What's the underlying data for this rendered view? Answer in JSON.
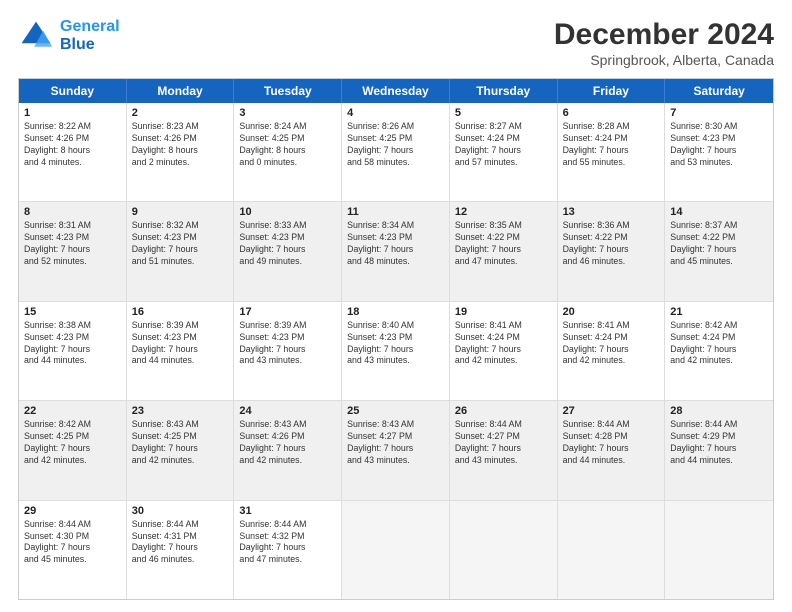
{
  "header": {
    "logo_line1": "General",
    "logo_line2": "Blue",
    "month": "December 2024",
    "location": "Springbrook, Alberta, Canada"
  },
  "days_of_week": [
    "Sunday",
    "Monday",
    "Tuesday",
    "Wednesday",
    "Thursday",
    "Friday",
    "Saturday"
  ],
  "rows": [
    [
      {
        "day": "1",
        "text": "Sunrise: 8:22 AM\nSunset: 4:26 PM\nDaylight: 8 hours\nand 4 minutes.",
        "shaded": false
      },
      {
        "day": "2",
        "text": "Sunrise: 8:23 AM\nSunset: 4:26 PM\nDaylight: 8 hours\nand 2 minutes.",
        "shaded": false
      },
      {
        "day": "3",
        "text": "Sunrise: 8:24 AM\nSunset: 4:25 PM\nDaylight: 8 hours\nand 0 minutes.",
        "shaded": false
      },
      {
        "day": "4",
        "text": "Sunrise: 8:26 AM\nSunset: 4:25 PM\nDaylight: 7 hours\nand 58 minutes.",
        "shaded": false
      },
      {
        "day": "5",
        "text": "Sunrise: 8:27 AM\nSunset: 4:24 PM\nDaylight: 7 hours\nand 57 minutes.",
        "shaded": false
      },
      {
        "day": "6",
        "text": "Sunrise: 8:28 AM\nSunset: 4:24 PM\nDaylight: 7 hours\nand 55 minutes.",
        "shaded": false
      },
      {
        "day": "7",
        "text": "Sunrise: 8:30 AM\nSunset: 4:23 PM\nDaylight: 7 hours\nand 53 minutes.",
        "shaded": false
      }
    ],
    [
      {
        "day": "8",
        "text": "Sunrise: 8:31 AM\nSunset: 4:23 PM\nDaylight: 7 hours\nand 52 minutes.",
        "shaded": true
      },
      {
        "day": "9",
        "text": "Sunrise: 8:32 AM\nSunset: 4:23 PM\nDaylight: 7 hours\nand 51 minutes.",
        "shaded": true
      },
      {
        "day": "10",
        "text": "Sunrise: 8:33 AM\nSunset: 4:23 PM\nDaylight: 7 hours\nand 49 minutes.",
        "shaded": true
      },
      {
        "day": "11",
        "text": "Sunrise: 8:34 AM\nSunset: 4:23 PM\nDaylight: 7 hours\nand 48 minutes.",
        "shaded": true
      },
      {
        "day": "12",
        "text": "Sunrise: 8:35 AM\nSunset: 4:22 PM\nDaylight: 7 hours\nand 47 minutes.",
        "shaded": true
      },
      {
        "day": "13",
        "text": "Sunrise: 8:36 AM\nSunset: 4:22 PM\nDaylight: 7 hours\nand 46 minutes.",
        "shaded": true
      },
      {
        "day": "14",
        "text": "Sunrise: 8:37 AM\nSunset: 4:22 PM\nDaylight: 7 hours\nand 45 minutes.",
        "shaded": true
      }
    ],
    [
      {
        "day": "15",
        "text": "Sunrise: 8:38 AM\nSunset: 4:23 PM\nDaylight: 7 hours\nand 44 minutes.",
        "shaded": false
      },
      {
        "day": "16",
        "text": "Sunrise: 8:39 AM\nSunset: 4:23 PM\nDaylight: 7 hours\nand 44 minutes.",
        "shaded": false
      },
      {
        "day": "17",
        "text": "Sunrise: 8:39 AM\nSunset: 4:23 PM\nDaylight: 7 hours\nand 43 minutes.",
        "shaded": false
      },
      {
        "day": "18",
        "text": "Sunrise: 8:40 AM\nSunset: 4:23 PM\nDaylight: 7 hours\nand 43 minutes.",
        "shaded": false
      },
      {
        "day": "19",
        "text": "Sunrise: 8:41 AM\nSunset: 4:24 PM\nDaylight: 7 hours\nand 42 minutes.",
        "shaded": false
      },
      {
        "day": "20",
        "text": "Sunrise: 8:41 AM\nSunset: 4:24 PM\nDaylight: 7 hours\nand 42 minutes.",
        "shaded": false
      },
      {
        "day": "21",
        "text": "Sunrise: 8:42 AM\nSunset: 4:24 PM\nDaylight: 7 hours\nand 42 minutes.",
        "shaded": false
      }
    ],
    [
      {
        "day": "22",
        "text": "Sunrise: 8:42 AM\nSunset: 4:25 PM\nDaylight: 7 hours\nand 42 minutes.",
        "shaded": true
      },
      {
        "day": "23",
        "text": "Sunrise: 8:43 AM\nSunset: 4:25 PM\nDaylight: 7 hours\nand 42 minutes.",
        "shaded": true
      },
      {
        "day": "24",
        "text": "Sunrise: 8:43 AM\nSunset: 4:26 PM\nDaylight: 7 hours\nand 42 minutes.",
        "shaded": true
      },
      {
        "day": "25",
        "text": "Sunrise: 8:43 AM\nSunset: 4:27 PM\nDaylight: 7 hours\nand 43 minutes.",
        "shaded": true
      },
      {
        "day": "26",
        "text": "Sunrise: 8:44 AM\nSunset: 4:27 PM\nDaylight: 7 hours\nand 43 minutes.",
        "shaded": true
      },
      {
        "day": "27",
        "text": "Sunrise: 8:44 AM\nSunset: 4:28 PM\nDaylight: 7 hours\nand 44 minutes.",
        "shaded": true
      },
      {
        "day": "28",
        "text": "Sunrise: 8:44 AM\nSunset: 4:29 PM\nDaylight: 7 hours\nand 44 minutes.",
        "shaded": true
      }
    ],
    [
      {
        "day": "29",
        "text": "Sunrise: 8:44 AM\nSunset: 4:30 PM\nDaylight: 7 hours\nand 45 minutes.",
        "shaded": false
      },
      {
        "day": "30",
        "text": "Sunrise: 8:44 AM\nSunset: 4:31 PM\nDaylight: 7 hours\nand 46 minutes.",
        "shaded": false
      },
      {
        "day": "31",
        "text": "Sunrise: 8:44 AM\nSunset: 4:32 PM\nDaylight: 7 hours\nand 47 minutes.",
        "shaded": false
      },
      {
        "day": "",
        "text": "",
        "shaded": true,
        "empty": true
      },
      {
        "day": "",
        "text": "",
        "shaded": true,
        "empty": true
      },
      {
        "day": "",
        "text": "",
        "shaded": true,
        "empty": true
      },
      {
        "day": "",
        "text": "",
        "shaded": true,
        "empty": true
      }
    ]
  ]
}
